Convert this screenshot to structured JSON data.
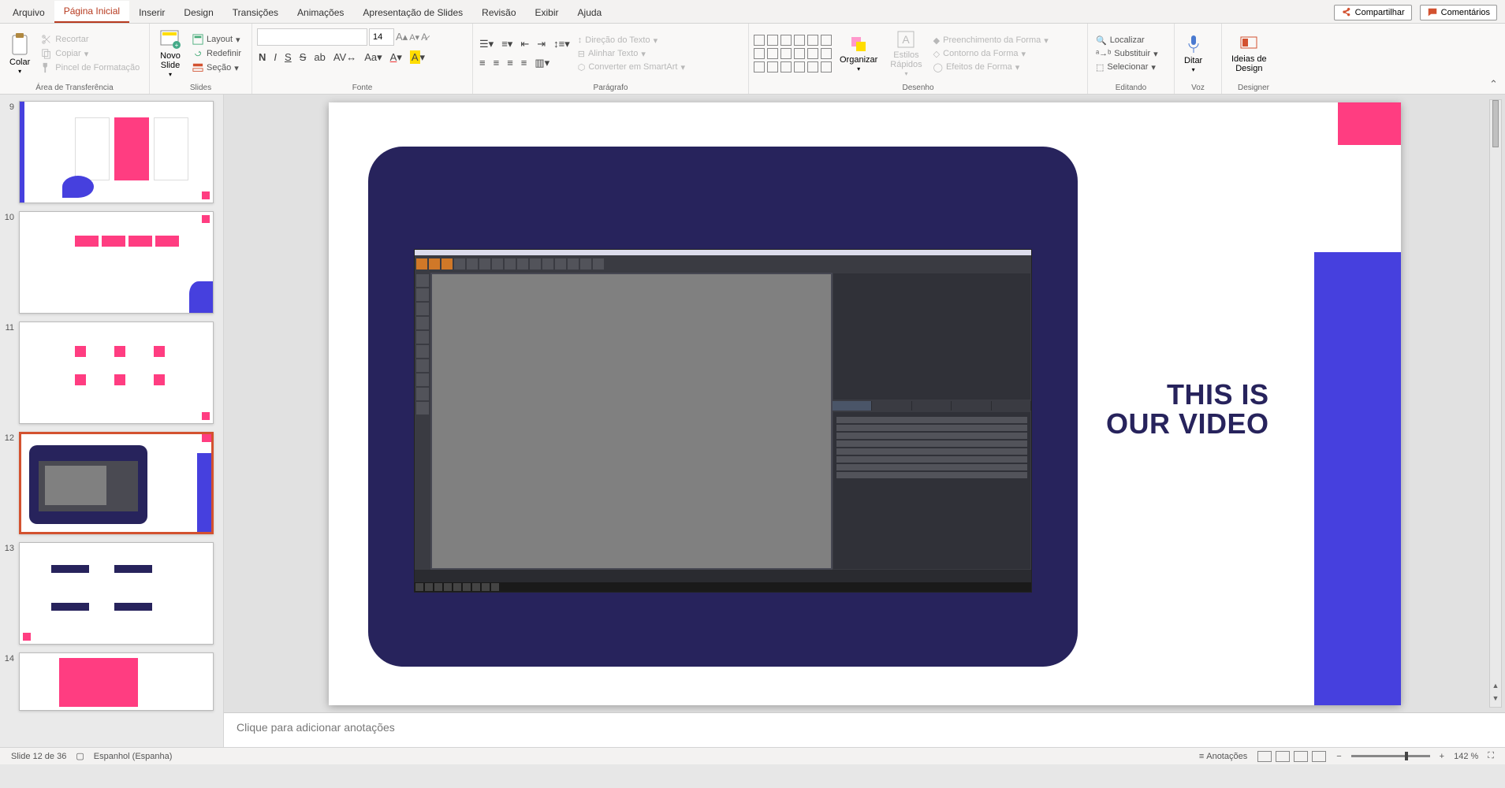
{
  "titlebar": {
    "share": "Compartilhar",
    "comments": "Comentários"
  },
  "tabs": [
    "Arquivo",
    "Página Inicial",
    "Inserir",
    "Design",
    "Transições",
    "Animações",
    "Apresentação de Slides",
    "Revisão",
    "Exibir",
    "Ajuda"
  ],
  "active_tab": 1,
  "clipboard": {
    "paste": "Colar",
    "cut": "Recortar",
    "copy": "Copiar",
    "format_painter": "Pincel de Formatação",
    "label": "Área de Transferência"
  },
  "slides": {
    "new": "",
    "new2": "Novo\nSlide",
    "layout": "Layout",
    "reset": "Redefinir",
    "section": "Seção",
    "label": "Slides"
  },
  "font": {
    "family": "",
    "size": "14",
    "label": "Fonte"
  },
  "paragraph": {
    "dir": "Direção do Texto",
    "align": "Alinhar Texto",
    "smartart": "Converter em SmartArt",
    "label": "Parágrafo"
  },
  "drawing": {
    "arrange": "Organizar",
    "styles": "Estilos\nRápidos",
    "fill": "Preenchimento da Forma",
    "outline": "Contorno da Forma",
    "effects": "Efeitos de Forma",
    "label": "Desenho"
  },
  "editing": {
    "find": "Localizar",
    "replace": "Substituir",
    "select": "Selecionar",
    "label": "Editando"
  },
  "voice": {
    "dictate": "Ditar",
    "label": "Voz"
  },
  "designer": {
    "ideas": "Ideias de\nDesign",
    "label": "Designer"
  },
  "thumbs": [
    {
      "n": "9"
    },
    {
      "n": "10"
    },
    {
      "n": "11"
    },
    {
      "n": "12",
      "sel": true
    },
    {
      "n": "13"
    },
    {
      "n": "14"
    }
  ],
  "slide": {
    "title_line1": "THIS IS",
    "title_line2": "OUR VIDEO"
  },
  "notes": {
    "placeholder": "Clique para adicionar anotações"
  },
  "status": {
    "slide_of": "Slide 12 de 36",
    "lang": "Espanhol (Espanha)",
    "notes_btn": "Anotações",
    "zoom": "142 %"
  }
}
